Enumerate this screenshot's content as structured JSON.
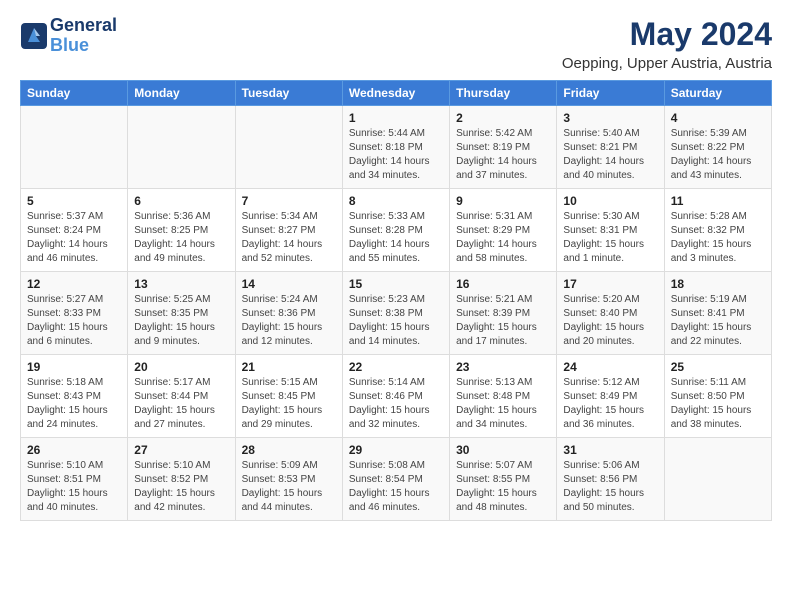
{
  "header": {
    "logo_line1": "General",
    "logo_line2": "Blue",
    "month": "May 2024",
    "location": "Oepping, Upper Austria, Austria"
  },
  "weekdays": [
    "Sunday",
    "Monday",
    "Tuesday",
    "Wednesday",
    "Thursday",
    "Friday",
    "Saturday"
  ],
  "weeks": [
    [
      {
        "day": "",
        "info": ""
      },
      {
        "day": "",
        "info": ""
      },
      {
        "day": "",
        "info": ""
      },
      {
        "day": "1",
        "info": "Sunrise: 5:44 AM\nSunset: 8:18 PM\nDaylight: 14 hours\nand 34 minutes."
      },
      {
        "day": "2",
        "info": "Sunrise: 5:42 AM\nSunset: 8:19 PM\nDaylight: 14 hours\nand 37 minutes."
      },
      {
        "day": "3",
        "info": "Sunrise: 5:40 AM\nSunset: 8:21 PM\nDaylight: 14 hours\nand 40 minutes."
      },
      {
        "day": "4",
        "info": "Sunrise: 5:39 AM\nSunset: 8:22 PM\nDaylight: 14 hours\nand 43 minutes."
      }
    ],
    [
      {
        "day": "5",
        "info": "Sunrise: 5:37 AM\nSunset: 8:24 PM\nDaylight: 14 hours\nand 46 minutes."
      },
      {
        "day": "6",
        "info": "Sunrise: 5:36 AM\nSunset: 8:25 PM\nDaylight: 14 hours\nand 49 minutes."
      },
      {
        "day": "7",
        "info": "Sunrise: 5:34 AM\nSunset: 8:27 PM\nDaylight: 14 hours\nand 52 minutes."
      },
      {
        "day": "8",
        "info": "Sunrise: 5:33 AM\nSunset: 8:28 PM\nDaylight: 14 hours\nand 55 minutes."
      },
      {
        "day": "9",
        "info": "Sunrise: 5:31 AM\nSunset: 8:29 PM\nDaylight: 14 hours\nand 58 minutes."
      },
      {
        "day": "10",
        "info": "Sunrise: 5:30 AM\nSunset: 8:31 PM\nDaylight: 15 hours\nand 1 minute."
      },
      {
        "day": "11",
        "info": "Sunrise: 5:28 AM\nSunset: 8:32 PM\nDaylight: 15 hours\nand 3 minutes."
      }
    ],
    [
      {
        "day": "12",
        "info": "Sunrise: 5:27 AM\nSunset: 8:33 PM\nDaylight: 15 hours\nand 6 minutes."
      },
      {
        "day": "13",
        "info": "Sunrise: 5:25 AM\nSunset: 8:35 PM\nDaylight: 15 hours\nand 9 minutes."
      },
      {
        "day": "14",
        "info": "Sunrise: 5:24 AM\nSunset: 8:36 PM\nDaylight: 15 hours\nand 12 minutes."
      },
      {
        "day": "15",
        "info": "Sunrise: 5:23 AM\nSunset: 8:38 PM\nDaylight: 15 hours\nand 14 minutes."
      },
      {
        "day": "16",
        "info": "Sunrise: 5:21 AM\nSunset: 8:39 PM\nDaylight: 15 hours\nand 17 minutes."
      },
      {
        "day": "17",
        "info": "Sunrise: 5:20 AM\nSunset: 8:40 PM\nDaylight: 15 hours\nand 20 minutes."
      },
      {
        "day": "18",
        "info": "Sunrise: 5:19 AM\nSunset: 8:41 PM\nDaylight: 15 hours\nand 22 minutes."
      }
    ],
    [
      {
        "day": "19",
        "info": "Sunrise: 5:18 AM\nSunset: 8:43 PM\nDaylight: 15 hours\nand 24 minutes."
      },
      {
        "day": "20",
        "info": "Sunrise: 5:17 AM\nSunset: 8:44 PM\nDaylight: 15 hours\nand 27 minutes."
      },
      {
        "day": "21",
        "info": "Sunrise: 5:15 AM\nSunset: 8:45 PM\nDaylight: 15 hours\nand 29 minutes."
      },
      {
        "day": "22",
        "info": "Sunrise: 5:14 AM\nSunset: 8:46 PM\nDaylight: 15 hours\nand 32 minutes."
      },
      {
        "day": "23",
        "info": "Sunrise: 5:13 AM\nSunset: 8:48 PM\nDaylight: 15 hours\nand 34 minutes."
      },
      {
        "day": "24",
        "info": "Sunrise: 5:12 AM\nSunset: 8:49 PM\nDaylight: 15 hours\nand 36 minutes."
      },
      {
        "day": "25",
        "info": "Sunrise: 5:11 AM\nSunset: 8:50 PM\nDaylight: 15 hours\nand 38 minutes."
      }
    ],
    [
      {
        "day": "26",
        "info": "Sunrise: 5:10 AM\nSunset: 8:51 PM\nDaylight: 15 hours\nand 40 minutes."
      },
      {
        "day": "27",
        "info": "Sunrise: 5:10 AM\nSunset: 8:52 PM\nDaylight: 15 hours\nand 42 minutes."
      },
      {
        "day": "28",
        "info": "Sunrise: 5:09 AM\nSunset: 8:53 PM\nDaylight: 15 hours\nand 44 minutes."
      },
      {
        "day": "29",
        "info": "Sunrise: 5:08 AM\nSunset: 8:54 PM\nDaylight: 15 hours\nand 46 minutes."
      },
      {
        "day": "30",
        "info": "Sunrise: 5:07 AM\nSunset: 8:55 PM\nDaylight: 15 hours\nand 48 minutes."
      },
      {
        "day": "31",
        "info": "Sunrise: 5:06 AM\nSunset: 8:56 PM\nDaylight: 15 hours\nand 50 minutes."
      },
      {
        "day": "",
        "info": ""
      }
    ]
  ]
}
